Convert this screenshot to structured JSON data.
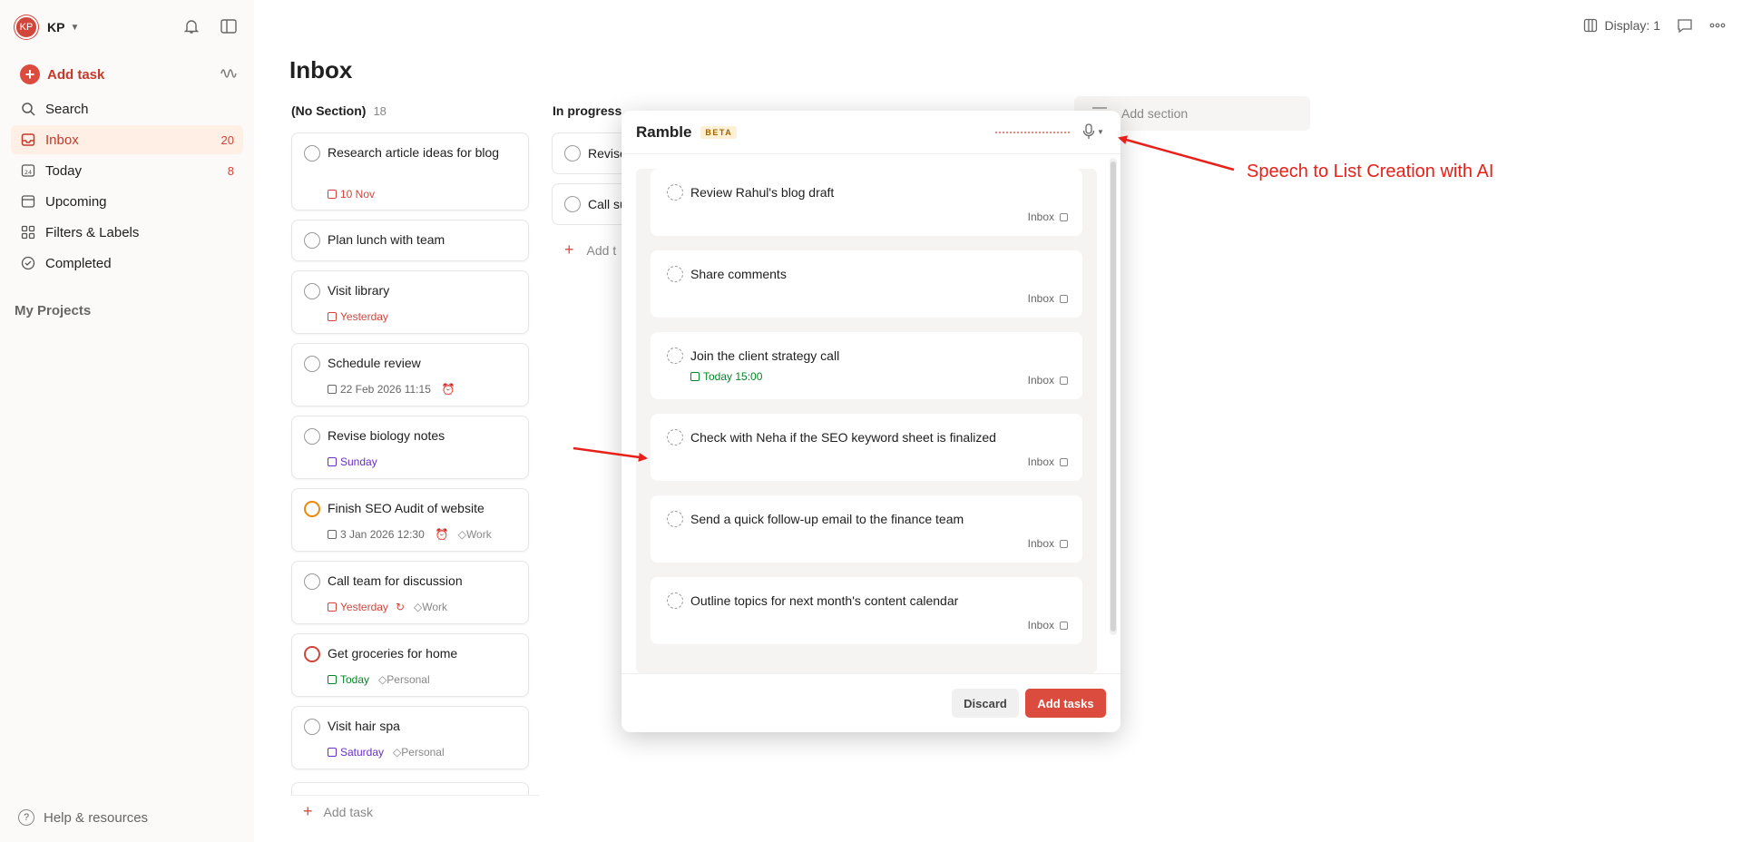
{
  "sidebar": {
    "user": {
      "initials": "KP",
      "name": "KP"
    },
    "add_task": "Add task",
    "items": [
      {
        "label": "Search",
        "count": ""
      },
      {
        "label": "Inbox",
        "count": "20"
      },
      {
        "label": "Today",
        "count": "8"
      },
      {
        "label": "Upcoming",
        "count": ""
      },
      {
        "label": "Filters & Labels",
        "count": ""
      },
      {
        "label": "Completed",
        "count": ""
      }
    ],
    "projects_heading": "My Projects",
    "help": "Help & resources",
    "today_icon_num": "24"
  },
  "toolbar": {
    "display": "Display: 1"
  },
  "main": {
    "title": "Inbox",
    "sections": [
      {
        "name": "(No Section)",
        "count": "18"
      },
      {
        "name": "In progress",
        "count": ""
      }
    ],
    "add_section": "Add section",
    "add_task": "Add task",
    "add_task_partial": "Add t",
    "tasks": [
      {
        "title": "Research article ideas for blog",
        "date": "10 Nov",
        "tag": ""
      },
      {
        "title": "Plan lunch with team",
        "date": "",
        "tag": ""
      },
      {
        "title": "Visit library",
        "date": "Yesterday",
        "tag": ""
      },
      {
        "title": "Schedule review",
        "date": "22 Feb 2026 11:15",
        "tag": ""
      },
      {
        "title": "Revise biology notes",
        "date": "Sunday",
        "tag": ""
      },
      {
        "title": "Finish SEO Audit of website",
        "date": "3 Jan 2026 12:30",
        "tag": "Work"
      },
      {
        "title": "Call team for discussion",
        "date": "Yesterday",
        "tag": "Work"
      },
      {
        "title": "Get groceries for home",
        "date": "Today",
        "tag": "Personal"
      },
      {
        "title": "Visit hair spa",
        "date": "Saturday",
        "tag": "Personal"
      }
    ],
    "col2_tasks": [
      "Revise",
      "Call su"
    ]
  },
  "modal": {
    "title": "Ramble",
    "badge": "BETA",
    "items": [
      {
        "title": "Review Rahul's blog draft",
        "project": "Inbox",
        "due": ""
      },
      {
        "title": "Share comments",
        "project": "Inbox",
        "due": ""
      },
      {
        "title": "Join the client strategy call",
        "project": "Inbox",
        "due": "Today 15:00"
      },
      {
        "title": "Check with Neha if the SEO keyword sheet is finalized",
        "project": "Inbox",
        "due": ""
      },
      {
        "title": "Send a quick follow-up email to the finance team",
        "project": "Inbox",
        "due": ""
      },
      {
        "title": "Outline topics for next month's content calendar",
        "project": "Inbox",
        "due": ""
      }
    ],
    "discard": "Discard",
    "add_tasks": "Add tasks"
  },
  "annotation": "Speech to List Creation with AI",
  "colors": {
    "accent": "#dc4c3e",
    "annotation": "#e8201a",
    "today_green": "#058527",
    "weekend_purple": "#692ec2"
  }
}
